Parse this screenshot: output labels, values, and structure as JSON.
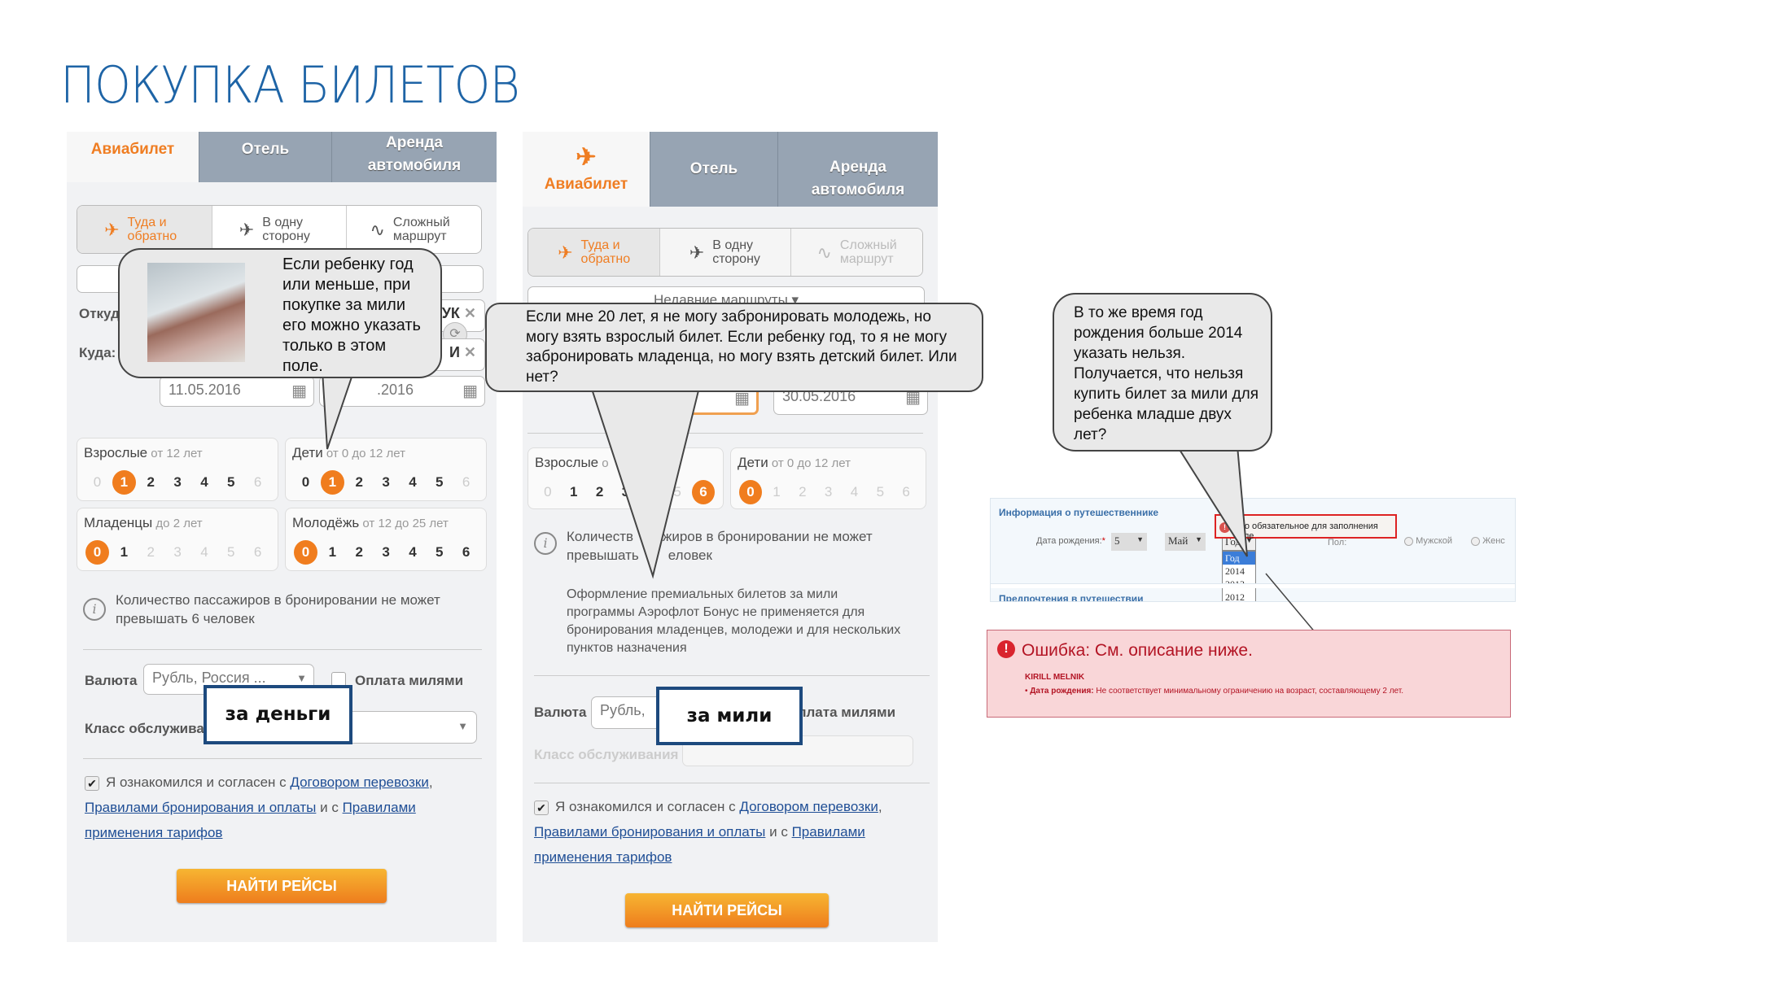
{
  "title": "ПОКУПКА БИЛЕТОВ",
  "tabs": [
    "Авиабилет",
    "Отель",
    "Аренда автомобиля"
  ],
  "route_types": [
    {
      "label": "Туда и обратно",
      "icon": "round-trip-plane-icon"
    },
    {
      "label": "В одну сторону",
      "icon": "plane-icon"
    },
    {
      "label": "Сложный маршрут",
      "icon": "zigzag-route-icon"
    }
  ],
  "recent_routes": "Недавние маршруты ▾",
  "from_label": "Откуда:",
  "to_label": "Куда:",
  "left_panel": {
    "from_value_partial": "УК",
    "to_value_partial": "И",
    "date_from": "11.05.2016",
    "date_to_partial": ".2016",
    "passengers": [
      {
        "name": "Взрослые",
        "range": "от 12 лет",
        "selected": 1,
        "enabled": [
          1,
          2,
          3,
          4,
          5
        ]
      },
      {
        "name": "Дети",
        "range": "от 0 до 12 лет",
        "selected": 1,
        "enabled": [
          0,
          1,
          2,
          3,
          4,
          5
        ]
      },
      {
        "name": "Младенцы",
        "range": "до 2 лет",
        "selected": 0,
        "enabled": [
          0,
          1
        ]
      },
      {
        "name": "Молодёжь",
        "range": "от 12 до 25 лет",
        "selected": 0,
        "enabled": [
          0,
          1,
          2,
          3,
          4,
          5,
          6
        ]
      }
    ],
    "info": "Количество пассажиров в бронировании не может превышать 6 человек",
    "currency_label": "Валюта",
    "currency_value": "Рубль, Россия ...",
    "pay_miles_label": "Оплата милями",
    "class_label": "Класс обслужива",
    "overlay_label": "за деньги"
  },
  "middle_panel": {
    "date_to": "30.05.2016",
    "passengers": [
      {
        "name": "Взрослые",
        "range": "о",
        "selected": 6,
        "enabled": [
          1,
          2,
          3
        ]
      },
      {
        "name": "Дети",
        "range": "от 0 до 12 лет",
        "selected": 0,
        "enabled": [
          0
        ]
      }
    ],
    "info": "Количество пассажиров в бронировании не может превышать 6 человек",
    "info_visible_1": "Количеств",
    "info_visible_1b": "сажиров в бронировании не может",
    "info_visible_2": "превышать",
    "info_visible_2b": "еловек",
    "bonus_note": "Оформление премиальных билетов за мили программы Аэрофлот Бонус не применяется для бронирования младенцев, молодежи и для нескольких пунктов назначения",
    "currency_label": "Валюта",
    "currency_value": "Рубль,",
    "pay_miles_label": "Оплата милями",
    "class_label": "Класс обслуживания",
    "overlay_label": "за мили"
  },
  "agreement": {
    "prefix": "Я ознакомился и согласен с",
    "link1": "Договором перевозки",
    "comma": ",",
    "link2": "Правилами бронирования и оплаты",
    "mid": "и с",
    "link3": "Правилами применения тарифов",
    "checked": true
  },
  "search_button": "НАЙТИ РЕЙСЫ",
  "callouts": {
    "left": "Если ребенку год или меньше, при покупке за мили его можно указать только в этом поле.",
    "middle": "Если мне 20 лет, я не могу забронировать молодежь, но могу взять взрослый билет. Если ребенку год, то я не могу забронировать младенца, но могу взять детский билет. Или нет?",
    "right": "В то же время год рождения больше 2014 указать нельзя. Получается, что нельзя купить билет за мили для ребенка младше двух лет?"
  },
  "traveler_form": {
    "section_title": "Информация о путешественнике",
    "dob_label": "Дата рождения:",
    "required_mark": "*",
    "day": "5",
    "month": "Май",
    "year_placeholder": "Год",
    "year_options": [
      "Год",
      "2014",
      "2013",
      "2012"
    ],
    "gender_label": "Пол:",
    "gender_options": [
      "Мужской",
      "Женс"
    ],
    "required_tooltip": "Это обязательное для заполнения поле",
    "next_section_partial": "Предпочтения в путешествии"
  },
  "error_box": {
    "title": "Ошибка: См. описание ниже.",
    "name": "KIRILL MELNIK",
    "field": "Дата рождения:",
    "message": "Не соответствует минимальному ограничению на возраст, составляющему 2 лет."
  },
  "colors": {
    "accent": "#ef7d22",
    "title_blue": "#1e64a6",
    "tab_gray": "#97a4b3",
    "error_red": "#c8102e"
  }
}
